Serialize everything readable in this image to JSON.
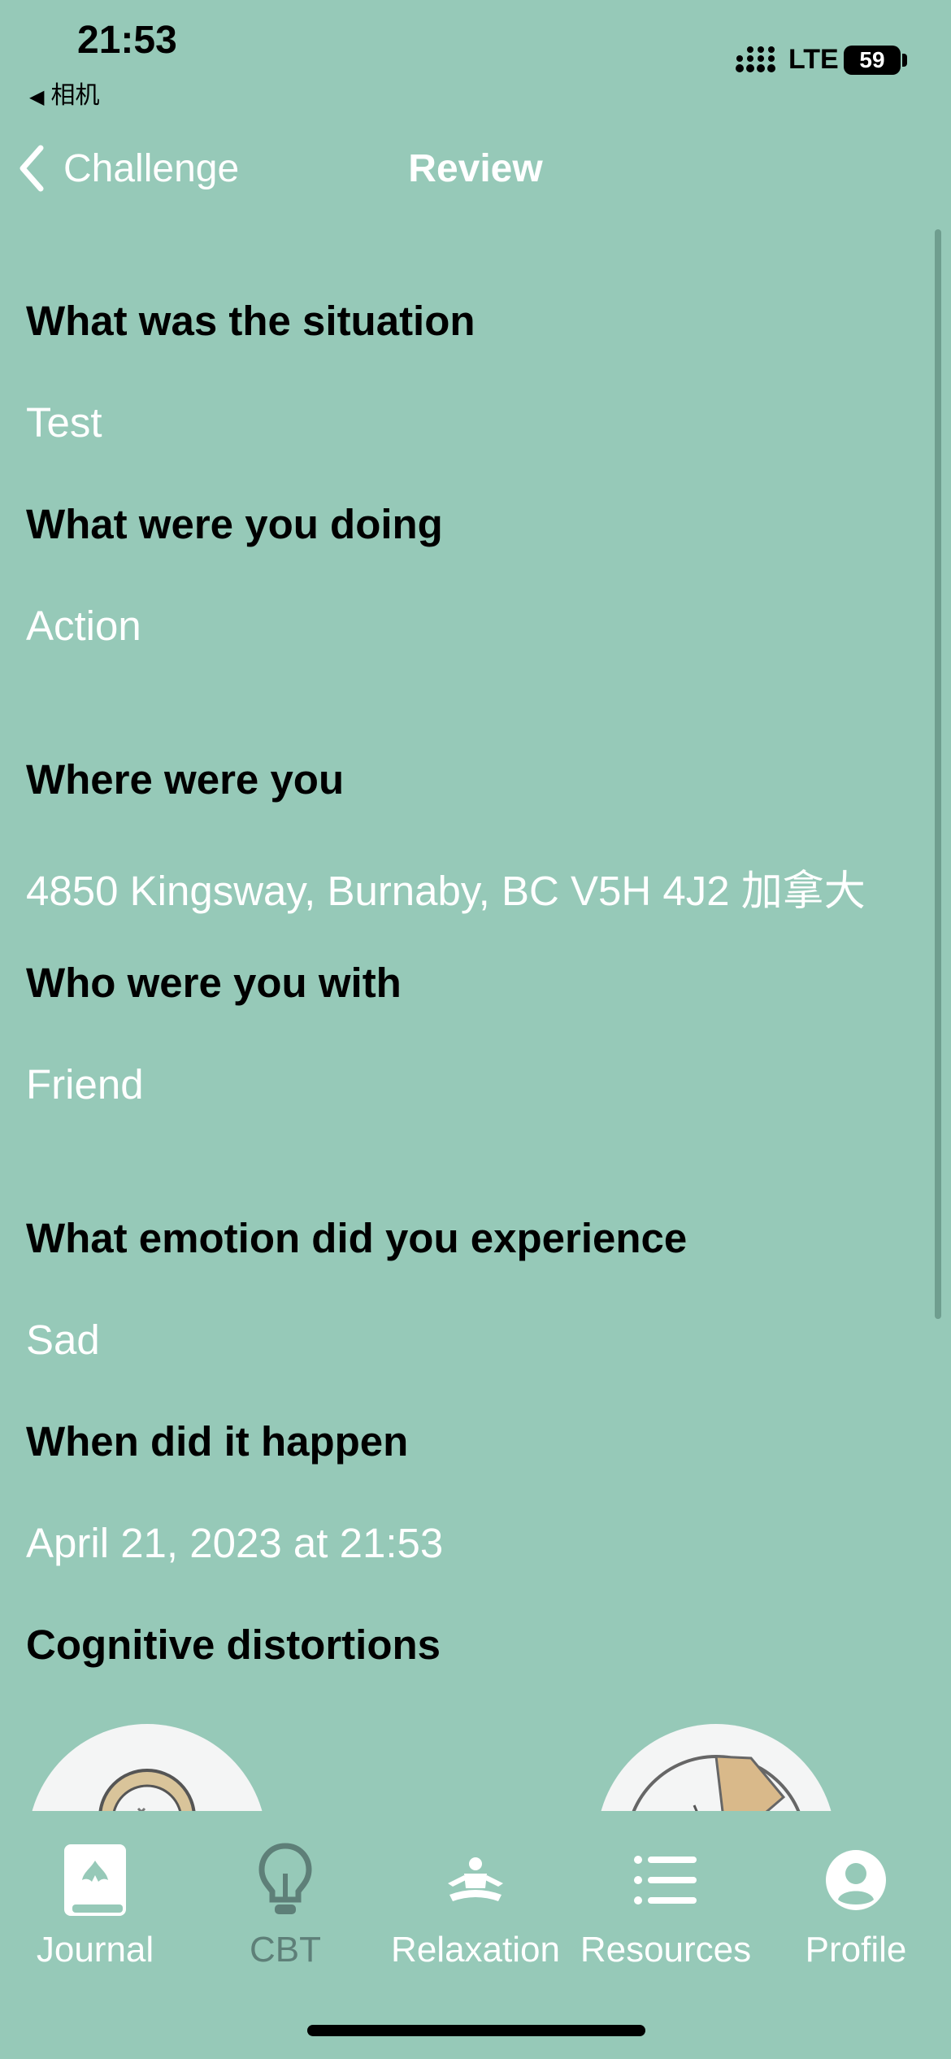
{
  "status_bar": {
    "time": "21:53",
    "back_app": "相机",
    "network": "LTE",
    "battery": "59"
  },
  "nav": {
    "back_label": "Challenge",
    "title": "Review"
  },
  "review": [
    {
      "question": "What was the situation",
      "answer": "Test"
    },
    {
      "question": "What were you doing",
      "answer": "Action"
    },
    {
      "question": "Where were you",
      "answer": "4850 Kingsway, Burnaby, BC V5H 4J2 加拿大"
    },
    {
      "question": "Who were you with",
      "answer": "Friend"
    },
    {
      "question": "What emotion did you experience",
      "answer": "Sad"
    },
    {
      "question": "When did it happen",
      "answer": "April 21, 2023 at 21:53"
    }
  ],
  "distortions_heading": "Cognitive distortions",
  "tabs": [
    {
      "label": "Journal",
      "icon": "journal-icon",
      "active": true
    },
    {
      "label": "CBT",
      "icon": "lightbulb-icon",
      "active": false
    },
    {
      "label": "Relaxation",
      "icon": "meditation-icon",
      "active": true
    },
    {
      "label": "Resources",
      "icon": "list-icon",
      "active": true
    },
    {
      "label": "Profile",
      "icon": "profile-icon",
      "active": true
    }
  ],
  "colors": {
    "background": "#96c9b8",
    "inactive_tab": "#5e7f78"
  }
}
